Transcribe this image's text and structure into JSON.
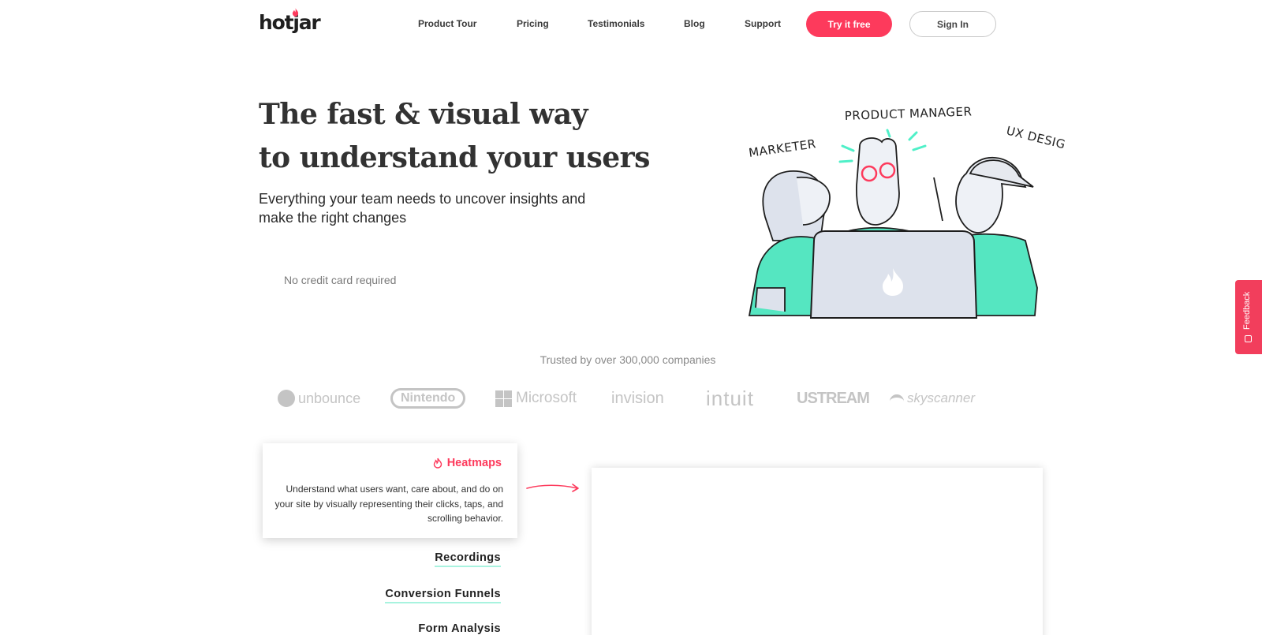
{
  "header": {
    "logo_text": "hotjar",
    "nav": [
      "Product Tour",
      "Pricing",
      "Testimonials",
      "Blog",
      "Support"
    ],
    "try_label": "Try it free",
    "signin_label": "Sign In"
  },
  "hero": {
    "title_line1": "The fast & visual way",
    "title_line2_prefix": "to ",
    "title_highlight": "understand your users",
    "subtitle": "Everything your team needs to uncover insights and make the right changes",
    "no_card": "No credit card required",
    "roles": [
      "MARKETER",
      "PRODUCT MANAGER",
      "UX DESIGNER"
    ]
  },
  "trusted": {
    "text": "Trusted by over 300,000 companies",
    "brands": [
      "unbounce",
      "Nintendo",
      "Microsoft",
      "invision",
      "intuit",
      "USTREAM",
      "skyscanner"
    ]
  },
  "features": {
    "active_title": "Heatmaps",
    "active_desc": "Understand what users want, care about, and do on your site by visually representing their clicks, taps, and scrolling behavior.",
    "items": [
      "Recordings",
      "Conversion Funnels",
      "Form Analysis"
    ]
  },
  "feedback": {
    "label": "Feedback"
  },
  "colors": {
    "brand_red": "#fd3a5c",
    "highlight": "#4ff0c8",
    "teal": "#55e6c1"
  }
}
